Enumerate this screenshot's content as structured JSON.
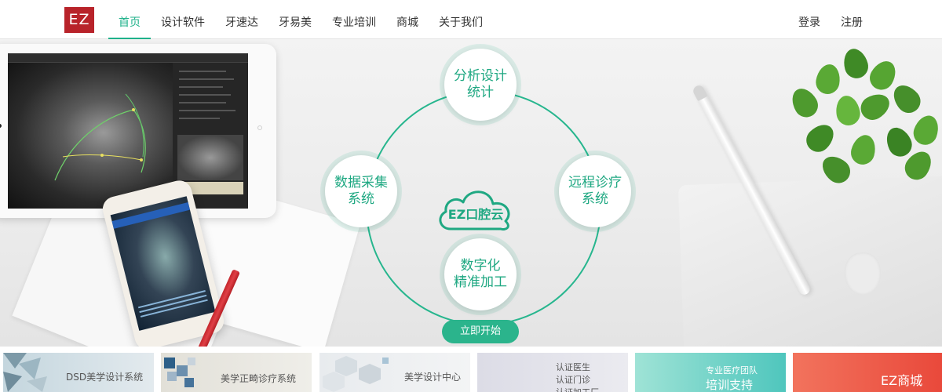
{
  "header": {
    "logo_text": "EZ",
    "nav": [
      "首页",
      "设计软件",
      "牙速达",
      "牙易美",
      "专业培训",
      "商城",
      "关于我们"
    ],
    "active_nav": "首页",
    "login_label": "登录",
    "register_label": "注册"
  },
  "banner": {
    "diagram": {
      "center_label": "EZ口腔云",
      "nodes": {
        "top": [
          "分析设计",
          "统计"
        ],
        "left": [
          "数据采集",
          "系统"
        ],
        "right": [
          "远程诊疗",
          "系统"
        ],
        "bottom": [
          "数字化",
          "精准加工"
        ]
      }
    },
    "start_button": "立即开始"
  },
  "cards": [
    {
      "label": "DSD美学设计系统",
      "bg": "#dde7ec"
    },
    {
      "label": "美学正畸诊疗系统",
      "bg": "#ecebe6"
    },
    {
      "label": "美学设计中心",
      "bg": "#eef0f2"
    },
    {
      "lines": [
        "认证医生",
        "认证门诊",
        "认证加工厂"
      ],
      "bg": "#e5e5ee"
    },
    {
      "sub": "专业医疗团队",
      "label": "培训支持",
      "bg": "#5fd0c4"
    },
    {
      "label": "EZ商城",
      "bg": "#ee5b46"
    }
  ],
  "colors": {
    "accent": "#1fb18a",
    "logo_red": "#b8232a",
    "button_green": "#2bb48c"
  }
}
